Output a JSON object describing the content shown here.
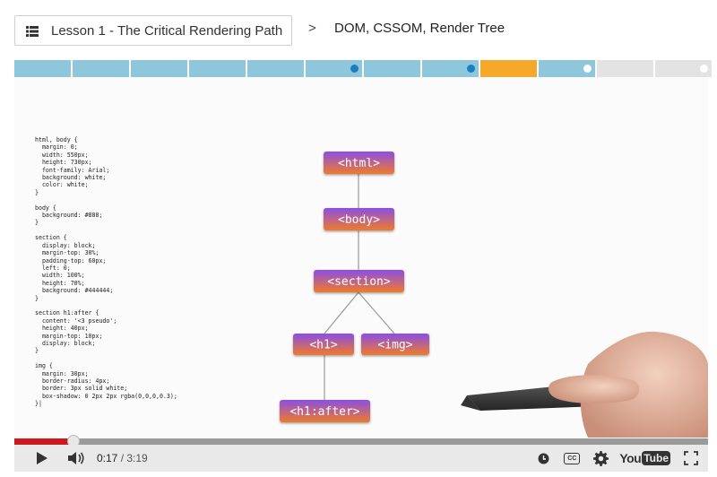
{
  "header": {
    "lesson_label": "Lesson 1 - The Critical Rendering Path",
    "breadcrumb_separator": ">",
    "current_title": "DOM, CSSOM, Render Tree",
    "menu_icon": "list-icon"
  },
  "progress": {
    "segments": [
      {
        "state": "done",
        "dot": "none"
      },
      {
        "state": "done",
        "dot": "none"
      },
      {
        "state": "done",
        "dot": "none"
      },
      {
        "state": "done",
        "dot": "none"
      },
      {
        "state": "done",
        "dot": "none"
      },
      {
        "state": "done",
        "dot": "blue"
      },
      {
        "state": "done",
        "dot": "none"
      },
      {
        "state": "done",
        "dot": "blue"
      },
      {
        "state": "current",
        "dot": "none"
      },
      {
        "state": "done",
        "dot": "white"
      },
      {
        "state": "todo",
        "dot": "none"
      },
      {
        "state": "todo",
        "dot": "white"
      }
    ],
    "colors": {
      "done": "#8ec6db",
      "current": "#f6a82b",
      "todo": "#e3e3e3",
      "dot_blue": "#1e7fc0"
    }
  },
  "video": {
    "code_text": "html, body {\n  margin: 0;\n  width: 550px;\n  height: 730px;\n  font-family: Arial;\n  background: white;\n  color: white;\n}\n\nbody {\n  background: #888;\n}\n\nsection {\n  display: block;\n  margin-top: 30%;\n  padding-top: 60px;\n  left: 0;\n  width: 100%;\n  height: 70%;\n  background: #444444;\n}\n\nsection h1:after {\n  content: '<3 pseudo';\n  height: 40px;\n  margin-top: 10px;\n  display: block;\n}\n\nimg {\n  margin: 30px;\n  border-radius: 4px;\n  border: 3px solid white;\n  box-shadow: 0 2px 2px rgba(0,0,0,0.3);\n}|",
    "tree_nodes": {
      "html": "<html>",
      "body": "<body>",
      "section": "<section>",
      "h1": "<h1>",
      "img": "<img>",
      "h1after": "<h1:after>"
    },
    "node_gradient": [
      "#8a4fe6",
      "#f07a2a"
    ]
  },
  "player": {
    "current_time": "0:17",
    "time_separator": " / ",
    "duration": "3:19",
    "progress_fraction": 0.085,
    "icons": [
      "play-icon",
      "volume-icon",
      "watch-later-icon",
      "captions-icon",
      "settings-icon",
      "youtube-logo",
      "fullscreen-icon"
    ],
    "captions_label": "CC",
    "youtube_you": "You",
    "youtube_tube": "Tube"
  }
}
